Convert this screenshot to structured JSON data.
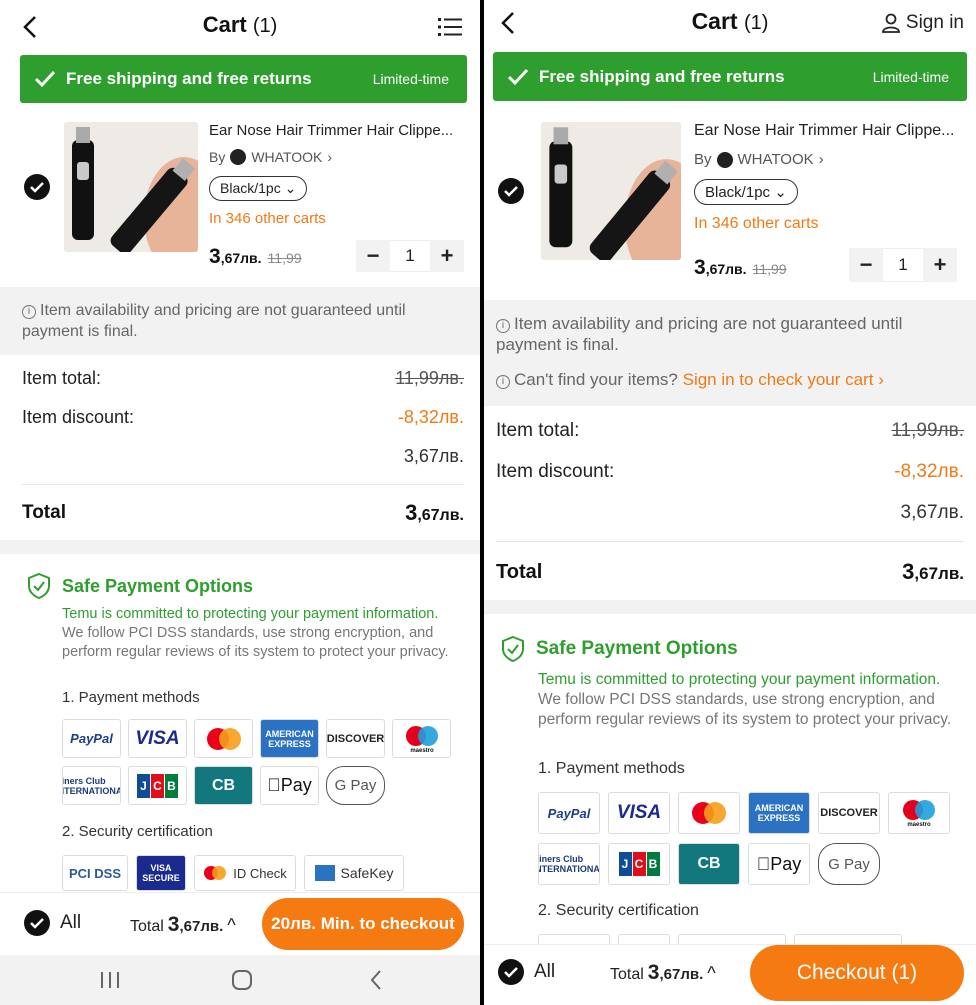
{
  "left": {
    "title": "Cart",
    "count": "(1)",
    "banner": {
      "text": "Free shipping and free returns",
      "tag": "Limited-time"
    },
    "product": {
      "name": "Ear Nose Hair Trimmer Hair Clippe...",
      "by": "By",
      "store": "WHATOOK",
      "variant": "Black/1pc",
      "in_carts": "In 346 other carts",
      "price_int": "3",
      "price_dec": ",67лв.",
      "old_price": "11,99",
      "qty": "1"
    },
    "notice": "Item availability and pricing are not guaranteed until payment is final.",
    "summary": {
      "item_total_label": "Item total:",
      "item_total_value": "11,99лв.",
      "item_discount_label": "Item discount:",
      "item_discount_value": "-8,32лв.",
      "subtotal": "3,67лв.",
      "total_label": "Total",
      "total_int": "3",
      "total_dec": ",67лв."
    },
    "safe": {
      "title": "Safe Payment Options",
      "text_green": "Temu is committed to protecting your payment information.",
      "text_gray": "We follow PCI DSS standards, use strong encryption, and perform regular reviews of its system to protect your privacy.",
      "methods_label": "1. Payment methods",
      "security_label": "2. Security certification"
    },
    "security_cards": [
      "PCI DSS",
      "VISA SECURE",
      "ID Check",
      "SafeKey"
    ],
    "bottom": {
      "all_label": "All",
      "total_label": "Total",
      "total_int": "3",
      "total_dec": ",67лв.",
      "checkout": "20лв. Min. to checkout"
    }
  },
  "right": {
    "title": "Cart",
    "count": "(1)",
    "signin": "Sign in",
    "banner": {
      "text": "Free shipping and free returns",
      "tag": "Limited-time"
    },
    "product": {
      "name": "Ear Nose Hair Trimmer Hair Clippe...",
      "by": "By",
      "store": "WHATOOK",
      "variant": "Black/1pc",
      "in_carts": "In 346 other carts",
      "price_int": "3",
      "price_dec": ",67лв.",
      "old_price": "11,99",
      "qty": "1"
    },
    "notice": "Item availability and pricing are not guaranteed until payment is final.",
    "cant_find": "Can't find your items?",
    "signin_link": "Sign in to check your cart",
    "summary": {
      "item_total_label": "Item total:",
      "item_total_value": "11,99лв.",
      "item_discount_label": "Item discount:",
      "item_discount_value": "-8,32лв.",
      "subtotal": "3,67лв.",
      "total_label": "Total",
      "total_int": "3",
      "total_dec": ",67лв."
    },
    "safe": {
      "title": "Safe Payment Options",
      "text_green": "Temu is committed to protecting your payment information.",
      "text_gray": "We follow PCI DSS standards, use strong encryption, and perform regular reviews of its system to protect your privacy.",
      "methods_label": "1. Payment methods",
      "security_label": "2. Security certification"
    },
    "bottom": {
      "all_label": "All",
      "total_label": "Total",
      "total_int": "3",
      "total_dec": ",67лв.",
      "checkout": "Checkout (1)"
    }
  },
  "payment_cards": [
    "PayPal",
    "VISA",
    "mastercard",
    "AMERICAN EXPRESS",
    "DISCOVER",
    "maestro",
    "Diners Club INTERNATIONAL",
    "JCB",
    "CB",
    "Pay",
    "G Pay"
  ],
  "colors": {
    "green": "#2e9e2e",
    "orange": "#f07a16",
    "checkout": "#f57a12"
  }
}
